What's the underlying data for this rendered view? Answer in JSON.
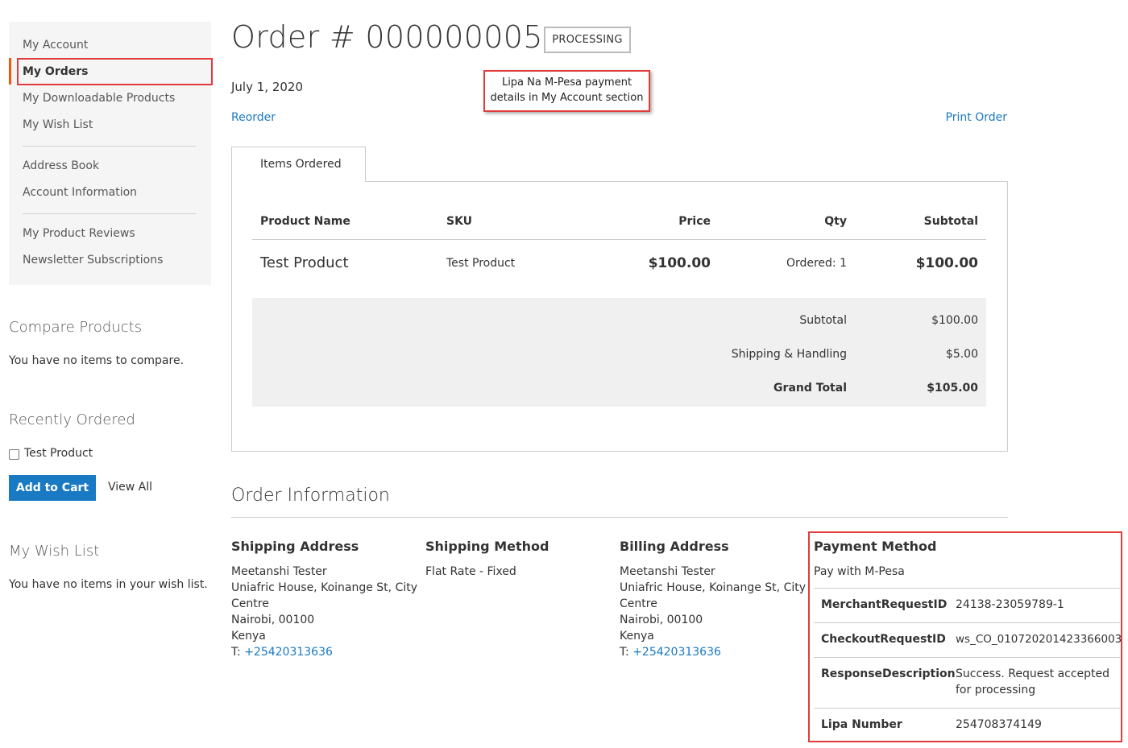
{
  "sidebar": {
    "nav": [
      {
        "label": "My Account"
      },
      {
        "label": "My Orders"
      },
      {
        "label": "My Downloadable Products"
      },
      {
        "label": "My Wish List"
      },
      {
        "label": "Address Book"
      },
      {
        "label": "Account Information"
      },
      {
        "label": "My Product Reviews"
      },
      {
        "label": "Newsletter Subscriptions"
      }
    ],
    "compare": {
      "title": "Compare Products",
      "text": "You have no items to compare."
    },
    "recently_ordered": {
      "title": "Recently Ordered",
      "item": "Test Product",
      "add_to_cart": "Add to Cart",
      "view_all": "View All"
    },
    "wishlist": {
      "title": "My Wish List",
      "text": "You have no items in your wish list."
    }
  },
  "order": {
    "title": "Order # 000000005",
    "status": "PROCESSING",
    "date": "July 1, 2020",
    "reorder": "Reorder",
    "print": "Print Order",
    "tab": "Items Ordered",
    "columns": {
      "name": "Product Name",
      "sku": "SKU",
      "price": "Price",
      "qty": "Qty",
      "subtotal": "Subtotal"
    },
    "item": {
      "name": "Test Product",
      "sku": "Test Product",
      "price": "$100.00",
      "qty": "Ordered: 1",
      "subtotal": "$100.00"
    },
    "totals": {
      "subtotal_label": "Subtotal",
      "subtotal": "$100.00",
      "shipping_label": "Shipping & Handling",
      "shipping": "$5.00",
      "grand_label": "Grand Total",
      "grand": "$105.00"
    }
  },
  "callout": {
    "line1": "Lipa Na M-Pesa payment",
    "line2": "details in My Account section"
  },
  "info": {
    "title": "Order Information",
    "shipping_address": {
      "title": "Shipping Address",
      "name": "Meetanshi Tester",
      "street1": "Uniafric House, Koinange St, City",
      "street2": "Centre",
      "city": "Nairobi, 00100",
      "country": "Kenya",
      "phone_prefix": "T: ",
      "phone": "+25420313636"
    },
    "shipping_method": {
      "title": "Shipping Method",
      "value": "Flat Rate - Fixed"
    },
    "billing_address": {
      "title": "Billing Address",
      "name": "Meetanshi Tester",
      "street1": "Uniafric House, Koinange St, City",
      "street2": "Centre",
      "city": "Nairobi, 00100",
      "country": "Kenya",
      "phone_prefix": "T: ",
      "phone": "+25420313636"
    },
    "payment": {
      "title": "Payment Method",
      "method": "Pay with M-Pesa",
      "rows": [
        {
          "label": "MerchantRequestID",
          "value": "24138-23059789-1"
        },
        {
          "label": "CheckoutRequestID",
          "value": "ws_CO_010720201423366003"
        },
        {
          "label": "ResponseDescription",
          "value": "Success. Request accepted for processing"
        },
        {
          "label": "Lipa Number",
          "value": "254708374149"
        }
      ]
    }
  },
  "colors": {
    "accent": "#1979c3",
    "nav_marker": "#ff5501",
    "highlight": "#e03c3c"
  }
}
